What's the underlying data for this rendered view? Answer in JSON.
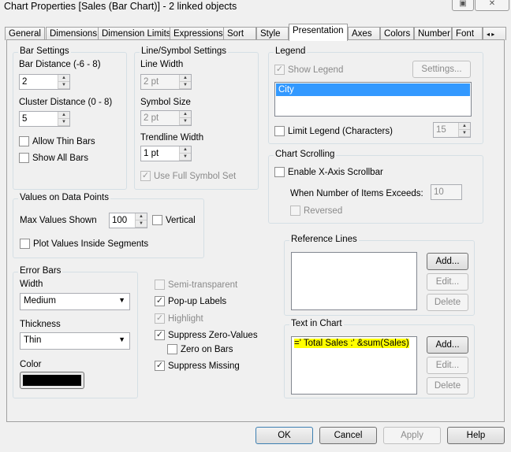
{
  "window": {
    "title": "Chart Properties [Sales (Bar Chart)] - 2 linked objects",
    "restore_icon": "restore-icon",
    "close_icon": "close-icon"
  },
  "tabs": [
    "General",
    "Dimensions",
    "Dimension Limits",
    "Expressions",
    "Sort",
    "Style",
    "Presentation",
    "Axes",
    "Colors",
    "Number",
    "Font"
  ],
  "active_tab": "Presentation",
  "bar_settings": {
    "label": "Bar Settings",
    "bar_distance_label": "Bar Distance (-6 - 8)",
    "bar_distance": "2",
    "cluster_distance_label": "Cluster Distance (0 - 8)",
    "cluster_distance": "5",
    "allow_thin_bars": "Allow Thin Bars",
    "show_all_bars": "Show All Bars"
  },
  "line_symbol": {
    "label": "Line/Symbol Settings",
    "line_width_label": "Line Width",
    "line_width": "2 pt",
    "symbol_size_label": "Symbol Size",
    "symbol_size": "2 pt",
    "trendline_width_label": "Trendline Width",
    "trendline_width": "1 pt",
    "use_full_symbol_set": "Use Full Symbol Set"
  },
  "legend": {
    "label": "Legend",
    "show_legend": "Show Legend",
    "settings": "Settings...",
    "items": [
      "City"
    ],
    "limit_legend": "Limit Legend (Characters)",
    "limit_value": "15"
  },
  "chart_scrolling": {
    "label": "Chart Scrolling",
    "enable_scrollbar": "Enable X-Axis Scrollbar",
    "when_exceeds": "When Number of Items Exceeds:",
    "exceeds_value": "10",
    "reversed": "Reversed"
  },
  "values_on_points": {
    "label": "Values on Data Points",
    "max_values_label": "Max Values Shown",
    "max_values": "100",
    "vertical": "Vertical",
    "plot_inside": "Plot Values Inside Segments"
  },
  "error_bars": {
    "label": "Error Bars",
    "width_label": "Width",
    "width": "Medium",
    "thickness_label": "Thickness",
    "thickness": "Thin",
    "color_label": "Color",
    "color": "#000000"
  },
  "options": {
    "semi_transparent": "Semi-transparent",
    "popup_labels": "Pop-up Labels",
    "highlight": "Highlight",
    "suppress_zero": "Suppress Zero-Values",
    "zero_on_bars": "Zero on Bars",
    "suppress_missing": "Suppress Missing"
  },
  "reference_lines": {
    "label": "Reference Lines",
    "add": "Add...",
    "edit": "Edit...",
    "delete": "Delete"
  },
  "text_in_chart": {
    "label": "Text in Chart",
    "items": [
      "=' Total Sales :' &sum(Sales)"
    ],
    "add": "Add...",
    "edit": "Edit...",
    "delete": "Delete"
  },
  "footer": {
    "ok": "OK",
    "cancel": "Cancel",
    "apply": "Apply",
    "help": "Help"
  }
}
